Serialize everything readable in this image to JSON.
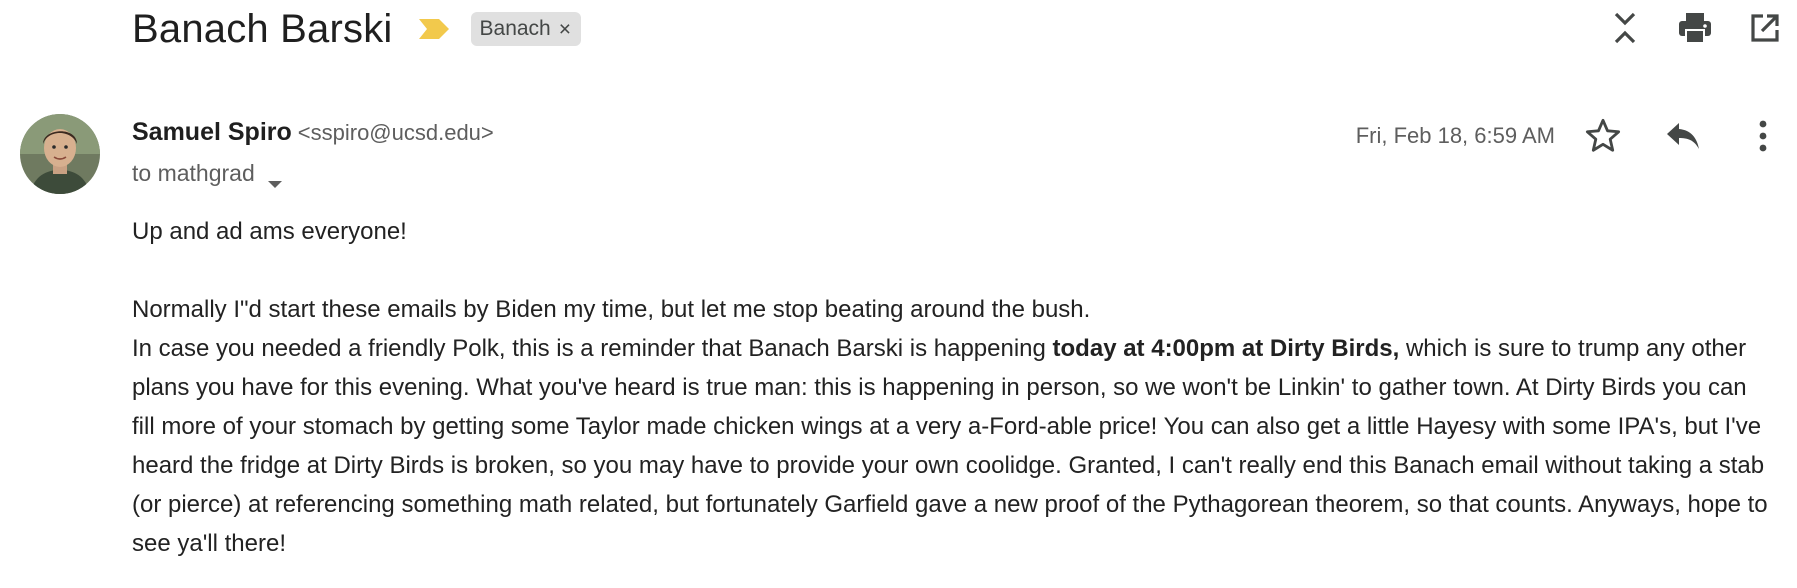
{
  "thread": {
    "subject": "Banach Barski",
    "label": "Banach"
  },
  "message": {
    "sender_name": "Samuel Spiro",
    "sender_email": "<sspiro@ucsd.edu>",
    "recipient": "to mathgrad",
    "date": "Fri, Feb 18, 6:59 AM"
  },
  "body": {
    "greeting": "Up and ad ams everyone!",
    "line1": "Normally I\"d start these emails by Biden my time, but let me stop beating around the bush.",
    "p2_pre": "In case you needed a friendly Polk, this is a reminder that Banach Barski is happening ",
    "p2_bold": "today at 4:00pm at Dirty Birds,",
    "p2_post": " which is sure to trump any other plans you have for this evening.  What you've heard is true man: this is happening in person, so we won't be Linkin' to gather town.  At Dirty Birds you can fill more of your stomach by getting some Taylor made chicken wings at a very a-Ford-able price!  You can also get a little Hayesy with some IPA's, but I've heard the fridge at Dirty Birds is broken, so you may have to provide your own coolidge.  Granted, I can't really end this Banach email without taking a stab (or pierce) at referencing something math related, but fortunately Garfield gave a new proof of the Pythagorean theorem, so that counts.  Anyways, hope to see ya'll there!"
  },
  "icons": {
    "importance": "importance-marker-icon",
    "label_remove": "close-icon",
    "collapse": "collapse-all-icon",
    "print": "print-icon",
    "new_window": "open-in-new-window-icon",
    "star": "star-icon",
    "reply": "reply-icon",
    "more": "more-vert-icon",
    "caret": "chevron-down-icon"
  },
  "colors": {
    "importance": "#f2c94c",
    "chip_bg": "#e0e0e0",
    "icon": "#444746",
    "text_muted": "#5e5e5e"
  }
}
